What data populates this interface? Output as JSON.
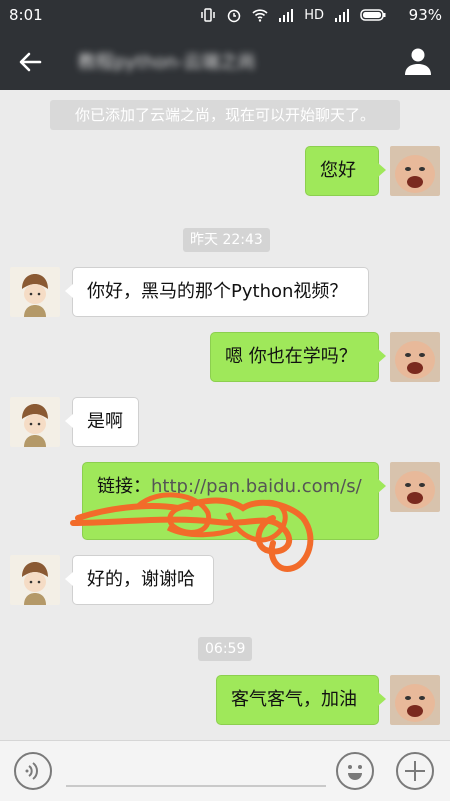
{
  "status_bar": {
    "time": "8:01",
    "network": "HD",
    "battery": "93%"
  },
  "nav": {
    "title": "教程python-云端之尚",
    "back_icon": "arrow-left-icon",
    "profile_icon": "person-icon"
  },
  "system_notice": "你已添加了云端之尚，现在可以开始聊天了。",
  "timestamps": [
    "昨天 22:43",
    "06:59"
  ],
  "messages": [
    {
      "from": "me",
      "text": "您好"
    },
    {
      "from": "other",
      "text": "你好，黑马的那个Python视频？"
    },
    {
      "from": "me",
      "text": "嗯 你也在学吗？"
    },
    {
      "from": "other",
      "text": "是啊"
    },
    {
      "from": "me",
      "label": "链接：",
      "url": "http://pan.baidu.com/s/"
    },
    {
      "from": "other",
      "text": "好的，谢谢哈"
    },
    {
      "from": "me",
      "text": "客气客气，加油"
    }
  ],
  "input_bar": {
    "voice_icon": "voice-icon",
    "emoji_icon": "emoji-icon",
    "add_icon": "plus-icon"
  },
  "colors": {
    "header": "#2f3236",
    "bubble_me": "#9fe85a",
    "background": "#ebebeb"
  }
}
